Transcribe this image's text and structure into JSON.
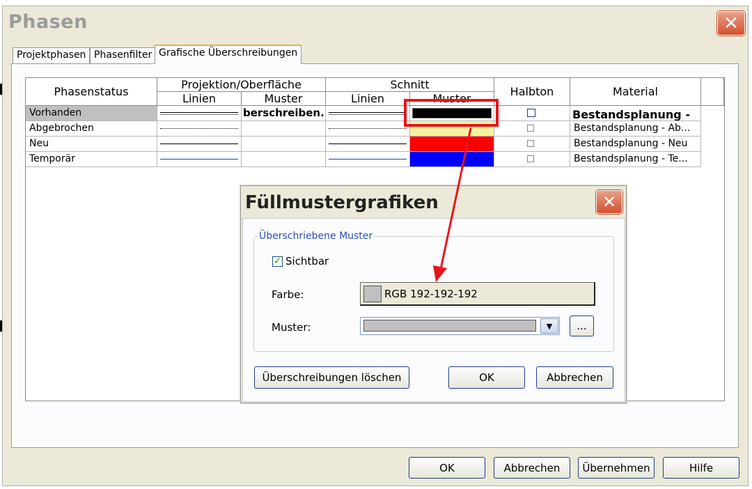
{
  "main_dialog": {
    "title": "Phasen",
    "tabs": [
      "Projektphasen",
      "Phasenfilter",
      "Grafische Überschreibungen"
    ],
    "active_tab": 2,
    "buttons": {
      "ok": "OK",
      "cancel": "Abbrechen",
      "apply": "Übernehmen",
      "help": "Hilfe"
    }
  },
  "table": {
    "headers": {
      "phase_status": "Phasenstatus",
      "projection_group": "Projektion/Oberfläche",
      "section_group": "Schnitt",
      "halftone": "Halbton",
      "material": "Material",
      "lines": "Linien",
      "pattern": "Muster"
    },
    "rows": [
      {
        "status": "Vorhanden",
        "proj_pattern": "berschreiben.",
        "section_pattern_color": "#000000",
        "material": "Bestandsplanung -",
        "selected": true
      },
      {
        "status": "Abgebrochen",
        "proj_pattern": "",
        "section_pattern_color": "#f4f4a0",
        "material": "Bestandsplanung - Ab..."
      },
      {
        "status": "Neu",
        "proj_pattern": "",
        "section_pattern_color": "#ff0000",
        "material": "Bestandsplanung - Neu"
      },
      {
        "status": "Temporär",
        "proj_pattern": "",
        "section_pattern_color": "#0000ff",
        "material": "Bestandsplanung - Te..."
      }
    ]
  },
  "fill_dialog": {
    "title": "Füllmustergrafiken",
    "group_label": "Überschriebene Muster",
    "visible_label": "Sichtbar",
    "visible_checked": true,
    "color_label": "Farbe:",
    "color_value": "RGB 192-192-192",
    "swatch_color": "#c0c0c0",
    "pattern_label": "Muster:",
    "browse_label": "...",
    "buttons": {
      "clear": "Überschreibungen löschen",
      "ok": "OK",
      "cancel": "Abbrechen"
    }
  },
  "colors": {
    "annotation": "#e8141a",
    "accent_tab": "#f0b040",
    "close_button": "#d2502e"
  }
}
